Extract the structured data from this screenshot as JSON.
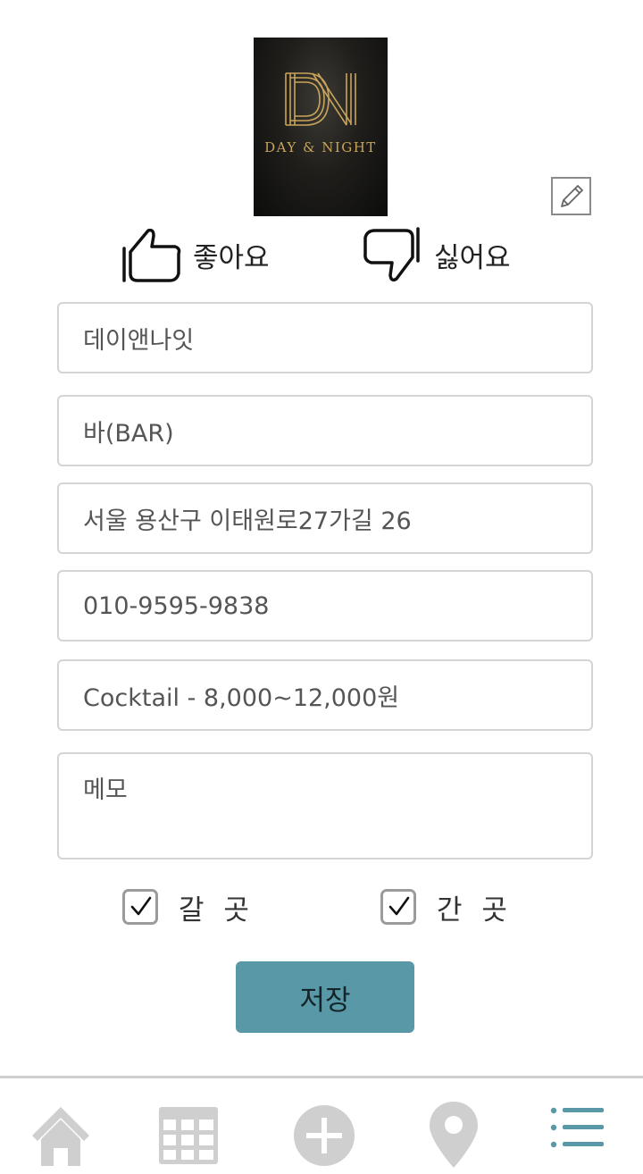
{
  "place": {
    "logo": {
      "line1": "DAY & NIGHT"
    },
    "edit_icon": "pencil-edit-icon"
  },
  "votes": {
    "like": {
      "label": "좋아요",
      "icon": "thumbs-up-icon"
    },
    "dislike": {
      "label": "싫어요",
      "icon": "thumbs-down-icon"
    }
  },
  "fields": {
    "name": "데이앤나잇",
    "category": "바(BAR)",
    "address": "서울 용산구 이태원로27가길 26",
    "phone": "010-9595-9838",
    "price": "Cocktail - 8,000~12,000원",
    "memo_placeholder": "메모"
  },
  "checks": {
    "to_go": {
      "label": "갈 곳",
      "checked": true
    },
    "visited": {
      "label": "간 곳",
      "checked": true
    }
  },
  "actions": {
    "save_label": "저장"
  },
  "colors": {
    "accent": "#5998a6",
    "nav_inactive": "#cfcfcf",
    "logo_gold": "#c9a45a"
  },
  "nav": [
    {
      "id": "home",
      "icon": "home-icon",
      "active": false
    },
    {
      "id": "grid",
      "icon": "grid-icon",
      "active": false
    },
    {
      "id": "add",
      "icon": "plus-circle-icon",
      "active": false
    },
    {
      "id": "map",
      "icon": "map-pin-icon",
      "active": false
    },
    {
      "id": "list",
      "icon": "list-icon",
      "active": true
    }
  ]
}
